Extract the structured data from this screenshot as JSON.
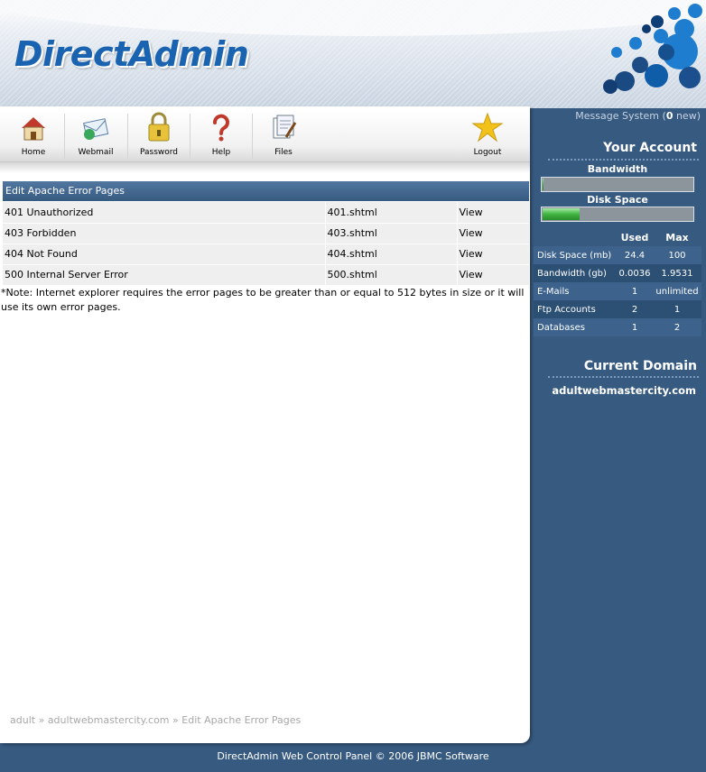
{
  "header": {
    "logo_text": "DirectAdmin"
  },
  "toolbar": {
    "items": [
      {
        "label": "Home",
        "icon": "home-icon"
      },
      {
        "label": "Webmail",
        "icon": "webmail-icon"
      },
      {
        "label": "Password",
        "icon": "lock-icon"
      },
      {
        "label": "Help",
        "icon": "help-icon"
      },
      {
        "label": "Files",
        "icon": "files-icon"
      },
      {
        "label": "Logout",
        "icon": "star-icon"
      }
    ]
  },
  "main": {
    "section_title": "Edit Apache Error Pages",
    "rows": [
      {
        "name": "401 Unauthorized",
        "file": "401.shtml",
        "action": "View"
      },
      {
        "name": "403 Forbidden",
        "file": "403.shtml",
        "action": "View"
      },
      {
        "name": "404 Not Found",
        "file": "404.shtml",
        "action": "View"
      },
      {
        "name": "500 Internal Server Error",
        "file": "500.shtml",
        "action": "View"
      }
    ],
    "note": "*Note: Internet explorer requires the error pages to be greater than or equal to 512 bytes in size or it will use its own error pages."
  },
  "breadcrumb": {
    "user": "adult",
    "sep1": "»",
    "domain": "adultwebmastercity.com",
    "sep2": "»",
    "page": "Edit Apache Error Pages"
  },
  "sidebar": {
    "message_label": "Message System (",
    "message_count": "0",
    "message_suffix": " new)",
    "your_account": "Your Account",
    "bandwidth_label": "Bandwidth",
    "bandwidth_fraction": 0.002,
    "disk_label": "Disk Space",
    "disk_fraction": 0.244,
    "col_used": "Used",
    "col_max": "Max",
    "stats": [
      {
        "name": "Disk Space (mb)",
        "used": "24.4",
        "max": "100"
      },
      {
        "name": "Bandwidth (gb)",
        "used": "0.0036",
        "max": "1.9531"
      },
      {
        "name": "E-Mails",
        "used": "1",
        "max": "unlimited"
      },
      {
        "name": "Ftp Accounts",
        "used": "2",
        "max": "1"
      },
      {
        "name": "Databases",
        "used": "1",
        "max": "2"
      }
    ],
    "current_domain_title": "Current Domain",
    "current_domain": "adultwebmastercity.com"
  },
  "footer": {
    "text": "DirectAdmin Web Control Panel © 2006 JBMC Software"
  },
  "colors": {
    "panel_blue": "#375a80",
    "logo_blue": "#1a63b0",
    "bar_green": "#3fb53f"
  }
}
